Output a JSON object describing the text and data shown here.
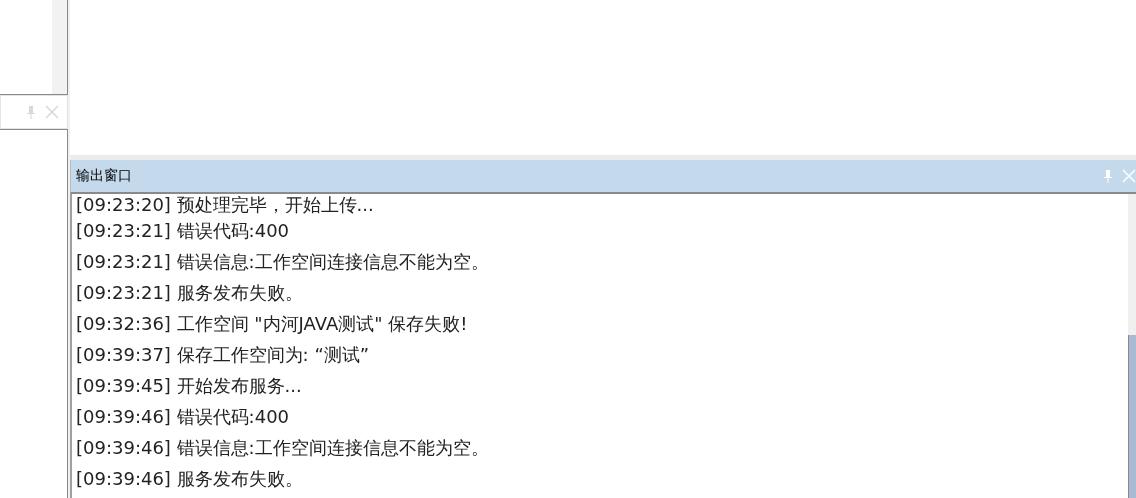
{
  "output_panel": {
    "title": "输出窗口",
    "lines": [
      "[09:23:20] 预处理完毕，开始上传...",
      "[09:23:21] 错误代码:400",
      "[09:23:21] 错误信息:工作空间连接信息不能为空。",
      "[09:23:21] 服务发布失败。",
      "[09:32:36] 工作空间 \"内河JAVA测试\" 保存失败!",
      "[09:39:37] 保存工作空间为: “测试”",
      "[09:39:45] 开始发布服务...",
      "[09:39:46] 错误代码:400",
      "[09:39:46] 错误信息:工作空间连接信息不能为空。",
      "[09:39:46] 服务发布失败。"
    ]
  }
}
